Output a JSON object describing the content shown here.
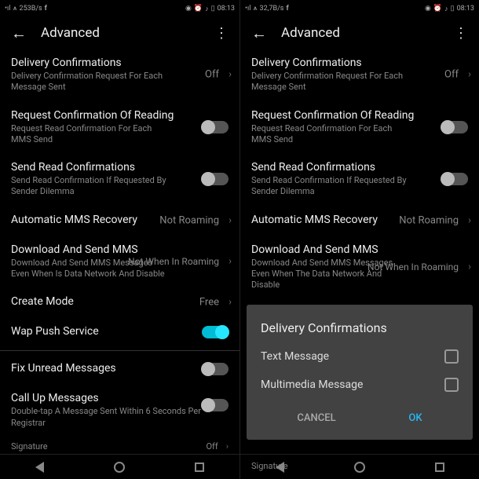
{
  "statusbar": {
    "left": {
      "speed": "253B/s",
      "speed2": "32,7B/s",
      "fb": "f"
    },
    "right": {
      "time": "08:13"
    }
  },
  "header": {
    "title": "Advanced"
  },
  "rows": {
    "delivery": {
      "title": "Delivery Confirmations",
      "sub": "Delivery Confirmation Request For Each Message Sent",
      "val": "Off"
    },
    "readreq": {
      "title": "Request Confirmation Of Reading",
      "sub": "Request Read Confirmation For Each MMS Send"
    },
    "sendread": {
      "title": "Send Read Confirmations",
      "sub": "Send Read Confirmation If Requested By Sender Dilemma"
    },
    "autorec": {
      "title": "Automatic MMS Recovery",
      "val": "Not Roaming"
    },
    "download": {
      "title": "Download And Send MMS",
      "sub": "Download And Send MMS Messages Even When Is Data Network And Disable",
      "val": "Not When In Roaming"
    },
    "download2": {
      "sub": "Download And Send MMS Messages Even When The Data Network And Disable"
    },
    "create": {
      "title": "Create Mode",
      "val": "Free"
    },
    "wap": {
      "title": "Wap Push Service"
    },
    "fix": {
      "title": "Fix Unread Messages"
    },
    "callup": {
      "title": "Call Up Messages",
      "sub": "Double-tap A Message Sent Within 6 Seconds Per Registrar"
    },
    "sig": {
      "label": "Signature",
      "val": "Off"
    }
  },
  "dialog": {
    "title": "Delivery Confirmations",
    "opt1": "Text Message",
    "opt2": "Multimedia Message",
    "cancel": "CANCEL",
    "ok": "OK"
  }
}
